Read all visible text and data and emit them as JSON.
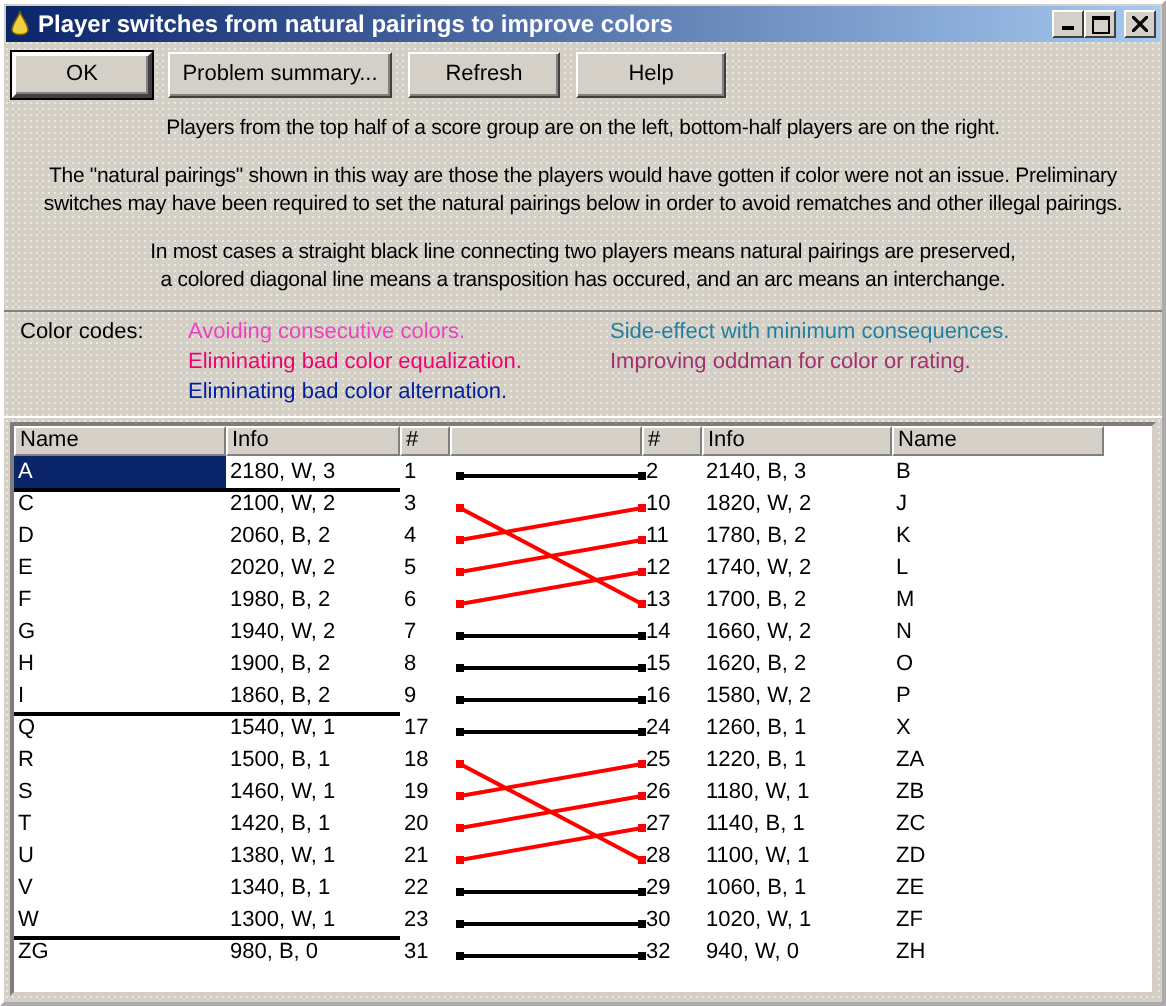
{
  "window": {
    "title": "Player switches from natural pairings to improve colors"
  },
  "buttons": [
    {
      "label": "OK",
      "default": true
    },
    {
      "label": "Problem summary...",
      "default": false
    },
    {
      "label": "Refresh",
      "default": false
    },
    {
      "label": "Help",
      "default": false
    }
  ],
  "notes": [
    "Players from the top half of a score group are on the left, bottom-half players are on the right.",
    "The \"natural pairings\" shown in this way are those the players would have gotten if color were not an issue. Preliminary\nswitches may have been required to set the natural pairings below in order to avoid rematches and other illegal pairings.",
    "In most cases a straight black line connecting two players means natural pairings are preserved,\na colored diagonal line means a transposition has occured, and an arc means an interchange."
  ],
  "color_codes": {
    "label": "Color codes:",
    "items": [
      {
        "text": "Avoiding consecutive colors.",
        "color": "#f040c0"
      },
      {
        "text": "Side-effect with minimum consequences.",
        "color": "#2080a0"
      },
      {
        "text": "Eliminating bad color equalization.",
        "color": "#f00070"
      },
      {
        "text": "Improving oddman for color or rating.",
        "color": "#a03070"
      },
      {
        "text": "Eliminating bad color alternation.",
        "color": "#0020a0"
      }
    ]
  },
  "columns": [
    "Name",
    "Info",
    "#",
    "#",
    "Info",
    "Name"
  ],
  "groups": [
    {
      "rows": [
        {
          "selected": true,
          "left": {
            "name": "A",
            "info": "2180, W, 3",
            "num": "1"
          },
          "right": {
            "num": "2",
            "info": "2140, B, 3",
            "name": "B"
          },
          "line": {
            "color": "#000000",
            "kind": "straight"
          }
        }
      ]
    },
    {
      "rows": [
        {
          "selected": false,
          "left": {
            "name": "C",
            "info": "2100, W, 2",
            "num": "3"
          },
          "right": {
            "num": "10",
            "info": "1820, W, 2",
            "name": "J"
          },
          "line": {
            "color": "#ff0000",
            "kind": "down"
          }
        },
        {
          "selected": false,
          "left": {
            "name": "D",
            "info": "2060, B, 2",
            "num": "4"
          },
          "right": {
            "num": "11",
            "info": "1780, B, 2",
            "name": "K"
          },
          "line": {
            "color": "#ff0000",
            "kind": "up"
          }
        },
        {
          "selected": false,
          "left": {
            "name": "E",
            "info": "2020, W, 2",
            "num": "5"
          },
          "right": {
            "num": "12",
            "info": "1740, W, 2",
            "name": "L"
          },
          "line": {
            "color": "#ff0000",
            "kind": "up"
          }
        },
        {
          "selected": false,
          "left": {
            "name": "F",
            "info": "1980, B, 2",
            "num": "6"
          },
          "right": {
            "num": "13",
            "info": "1700, B, 2",
            "name": "M"
          },
          "line": {
            "color": "#ff0000",
            "kind": "up"
          }
        },
        {
          "selected": false,
          "left": {
            "name": "G",
            "info": "1940, W, 2",
            "num": "7"
          },
          "right": {
            "num": "14",
            "info": "1660, W, 2",
            "name": "N"
          },
          "line": {
            "color": "#000000",
            "kind": "straight"
          }
        },
        {
          "selected": false,
          "left": {
            "name": "H",
            "info": "1900, B, 2",
            "num": "8"
          },
          "right": {
            "num": "15",
            "info": "1620, B, 2",
            "name": "O"
          },
          "line": {
            "color": "#000000",
            "kind": "straight"
          }
        },
        {
          "selected": false,
          "left": {
            "name": "I",
            "info": "1860, B, 2",
            "num": "9"
          },
          "right": {
            "num": "16",
            "info": "1580, W, 2",
            "name": "P"
          },
          "line": {
            "color": "#000000",
            "kind": "straight"
          }
        }
      ]
    },
    {
      "rows": [
        {
          "selected": false,
          "left": {
            "name": "Q",
            "info": "1540, W, 1",
            "num": "17"
          },
          "right": {
            "num": "24",
            "info": "1260, B, 1",
            "name": "X"
          },
          "line": {
            "color": "#000000",
            "kind": "straight"
          }
        },
        {
          "selected": false,
          "left": {
            "name": "R",
            "info": "1500, B, 1",
            "num": "18"
          },
          "right": {
            "num": "25",
            "info": "1220, B, 1",
            "name": "ZA"
          },
          "line": {
            "color": "#ff0000",
            "kind": "down"
          }
        },
        {
          "selected": false,
          "left": {
            "name": "S",
            "info": "1460, W, 1",
            "num": "19"
          },
          "right": {
            "num": "26",
            "info": "1180, W, 1",
            "name": "ZB"
          },
          "line": {
            "color": "#ff0000",
            "kind": "up"
          }
        },
        {
          "selected": false,
          "left": {
            "name": "T",
            "info": "1420, B, 1",
            "num": "20"
          },
          "right": {
            "num": "27",
            "info": "1140, B, 1",
            "name": "ZC"
          },
          "line": {
            "color": "#ff0000",
            "kind": "up"
          }
        },
        {
          "selected": false,
          "left": {
            "name": "U",
            "info": "1380, W, 1",
            "num": "21"
          },
          "right": {
            "num": "28",
            "info": "1100, W, 1",
            "name": "ZD"
          },
          "line": {
            "color": "#ff0000",
            "kind": "up"
          }
        },
        {
          "selected": false,
          "left": {
            "name": "V",
            "info": "1340, B, 1",
            "num": "22"
          },
          "right": {
            "num": "29",
            "info": "1060, B, 1",
            "name": "ZE"
          },
          "line": {
            "color": "#000000",
            "kind": "straight"
          }
        },
        {
          "selected": false,
          "left": {
            "name": "W",
            "info": "1300, W, 1",
            "num": "23"
          },
          "right": {
            "num": "30",
            "info": "1020, W, 1",
            "name": "ZF"
          },
          "line": {
            "color": "#000000",
            "kind": "straight"
          }
        }
      ]
    },
    {
      "rows": [
        {
          "selected": false,
          "left": {
            "name": "ZG",
            "info": "980, B, 0",
            "num": "31"
          },
          "right": {
            "num": "32",
            "info": "940, W, 0",
            "name": "ZH"
          },
          "line": {
            "color": "#000000",
            "kind": "straight"
          }
        }
      ]
    }
  ]
}
